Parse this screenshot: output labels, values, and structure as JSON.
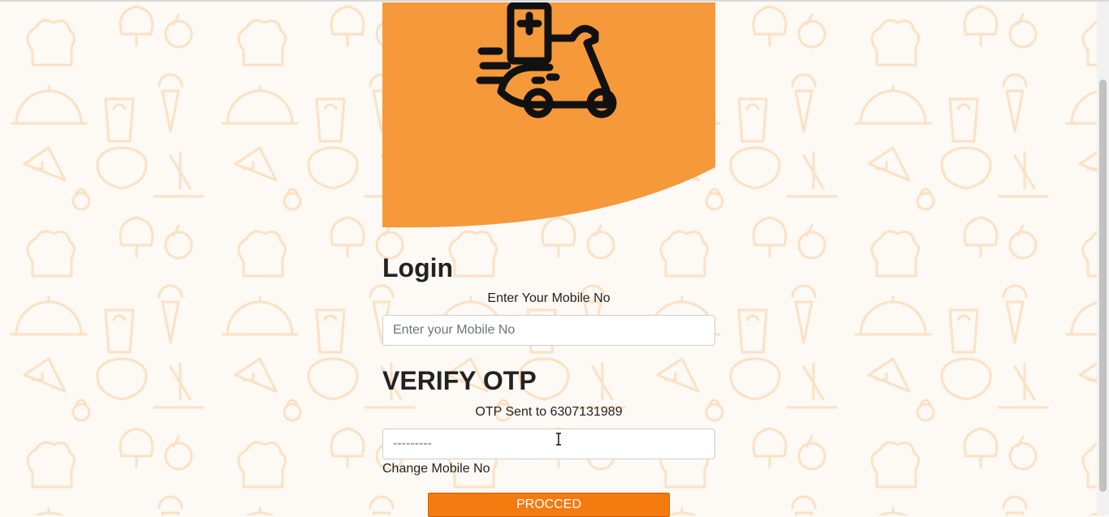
{
  "colors": {
    "accent": "#f5993a",
    "button": "#f57a10",
    "pattern": "#fbe3c9"
  },
  "hero": {
    "icon": "delivery-scooter-icon"
  },
  "login": {
    "title": "Login",
    "mobile_label": "Enter Your Mobile No",
    "mobile_placeholder": "Enter your Mobile No"
  },
  "verify": {
    "title": "VERIFY OTP",
    "otp_sent_text": "OTP Sent to 6307131989",
    "otp_placeholder": "---------",
    "change_mobile": "Change Mobile No",
    "proceed_label": "PROCCED"
  }
}
